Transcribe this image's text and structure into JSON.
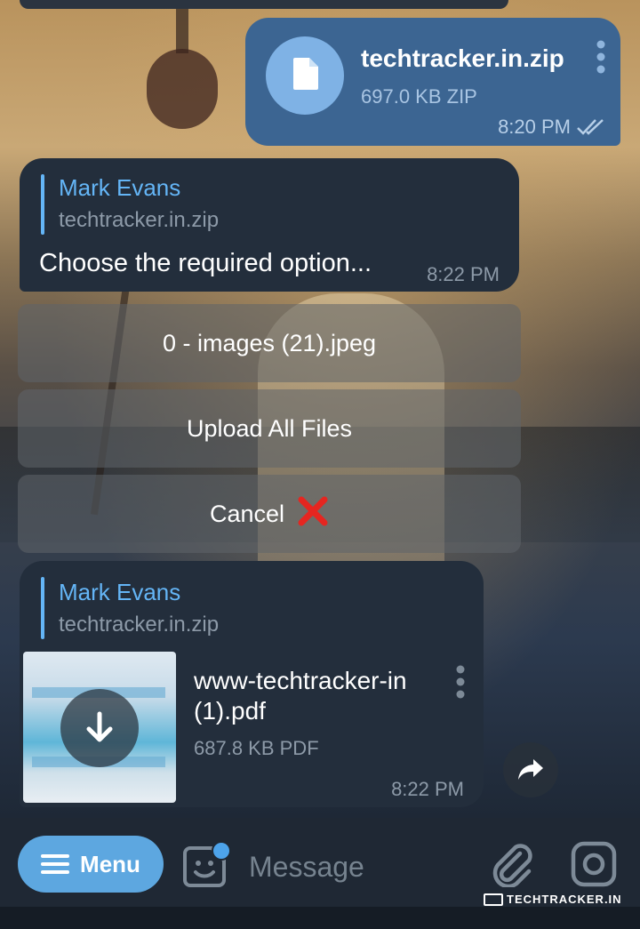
{
  "outgoing_file": {
    "name": "techtracker.in.zip",
    "size": "697.0 KB ZIP",
    "time": "8:20 PM",
    "status": "read"
  },
  "bot_message": {
    "reply_name": "Mark Evans",
    "reply_file": "techtracker.in.zip",
    "text": "Choose the required option...",
    "time": "8:22 PM"
  },
  "keyboard_buttons": [
    {
      "label": "0 - images (21).jpeg"
    },
    {
      "label": "Upload All Files"
    },
    {
      "label": "Cancel"
    }
  ],
  "pdf_message": {
    "reply_name": "Mark Evans",
    "reply_file": "techtracker.in.zip",
    "file_name": "www-techtracker-in (1).pdf",
    "size": "687.8 KB PDF",
    "time": "8:22 PM"
  },
  "input_bar": {
    "menu_label": "Menu",
    "placeholder": "Message"
  },
  "watermark": "TECHTRACKER.IN",
  "colors": {
    "outgoing_bubble": "#3c6592",
    "incoming_bubble": "#232e3c",
    "accent": "#64b5f6",
    "menu_button": "#5da7e0",
    "cancel_x": "#e52620"
  }
}
